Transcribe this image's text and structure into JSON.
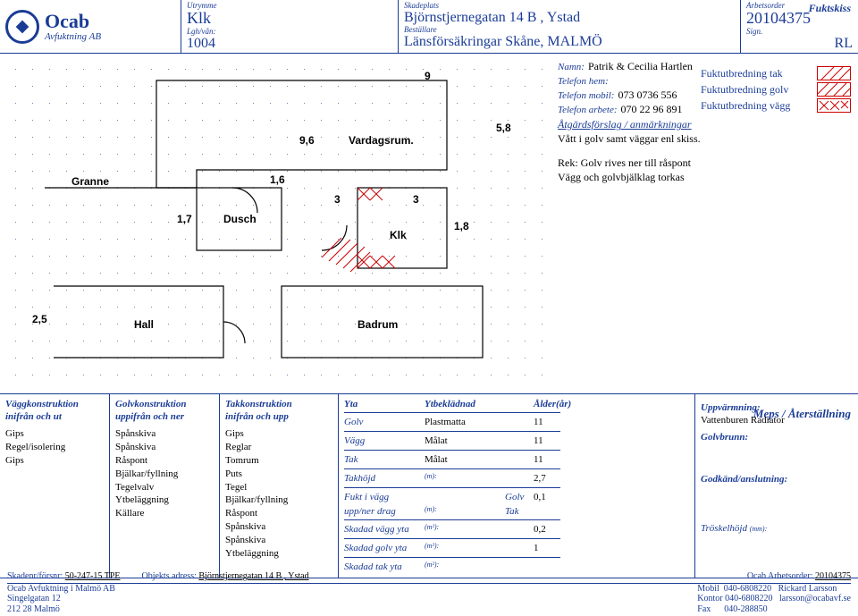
{
  "title_right": "Fuktskiss",
  "logo": {
    "brand": "Ocab",
    "sub": "Avfuktning AB"
  },
  "header": {
    "utrymme_lbl": "Utrymme",
    "utrymme": "Klk",
    "lgh_lbl": "Lgh/vån:",
    "lgh": "1004",
    "skadeplats_lbl": "Skadeplats",
    "skadeplats": "Björnstjernegatan 14 B , Ystad",
    "bestallare_lbl": "Beställare",
    "bestallare": "Länsförsäkringar Skåne, MALMÖ",
    "arbetsorder_lbl": "Arbetsorder",
    "arbetsorder": "20104375",
    "sign_lbl": "Sign.",
    "sign": "RL"
  },
  "contact": {
    "namn_lbl": "Namn:",
    "namn": "Patrik & Cecilia Hartlen",
    "hem_lbl": "Telefon hem:",
    "hem": "",
    "mobil_lbl": "Telefon mobil:",
    "mobil": "073 0736 556",
    "arbete_lbl": "Telefon arbete:",
    "arbete": "070 22 96 891"
  },
  "atg_hdr": "Åtgärdsförslag / anmärkningar",
  "atg1": "Vått i golv samt väggar enl skiss.",
  "atg2": "Rek: Golv rives ner till råspont",
  "atg3": "Vägg och golvbjälklag torkas",
  "legend": {
    "tak": "Fuktutbredning tak",
    "golv": "Fuktutbredning golv",
    "vagg": "Fuktutbredning vägg"
  },
  "plan": {
    "m96": "9,6",
    "vardagsrum": "Vardagsrum.",
    "m9": "9",
    "m58": "5,8",
    "granne": "Granne",
    "m16": "1,6",
    "m17": "1,7",
    "dusch": "Dusch",
    "m3b": "3",
    "m3a": "3",
    "klk": "Klk",
    "m18": "1,8",
    "m25": "2,5",
    "hall": "Hall",
    "badrum": "Badrum"
  },
  "meps": "Meps / Återställning",
  "cols": {
    "vagg_h1": "Väggkonstruktion",
    "vagg_h2": "inifrån och ut",
    "vagg": [
      "Gips",
      "Regel/isolering",
      "Gips"
    ],
    "golv_h1": "Golvkonstruktion",
    "golv_h2": "uppifrån och ner",
    "golv": [
      "Spånskiva",
      "Spånskiva",
      "Råspont",
      "Bjälkar/fyllning",
      "Tegelvalv",
      "Ytbeläggning",
      "Källare"
    ],
    "tak_h1": "Takkonstruktion",
    "tak_h2": "inifrån och upp",
    "tak": [
      "Gips",
      "Reglar",
      "Tomrum",
      "Puts",
      "Tegel",
      "Bjälkar/fyllning",
      "Råspont",
      "Spånskiva",
      "Spånskiva",
      "Ytbeläggning"
    ]
  },
  "yt": {
    "h_yta": "Yta",
    "h_bek": "Ytbeklädnad",
    "h_ald": "Ålder(år)",
    "golv_l": "Golv",
    "golv_b": "Plastmatta",
    "golv_a": "11",
    "vagg_l": "Vägg",
    "vagg_b": "Målat",
    "vagg_a": "11",
    "tak_l": "Tak",
    "tak_b": "Målat",
    "tak_a": "11",
    "takh_l": "Takhöjd",
    "takh_u": "(m):",
    "takh_v": "2,7",
    "fukt_l": "Fukt i vägg",
    "fukt_g": "Golv",
    "fukt_v": "0,1",
    "upp_l": "upp/ner drag",
    "upp_u": "(m):",
    "upp_t": "Tak",
    "svy_l": "Skadad vägg yta",
    "svy_u": "(m²):",
    "svy_v": "0,2",
    "sgy_l": "Skadad golv yta",
    "sgy_u": "(m²):",
    "sgy_v": "1",
    "sty_l": "Skadad tak yta",
    "sty_u": "(m²):"
  },
  "right": {
    "upp": "Uppvärmning:",
    "upp_v": "Vattenburen Radiator",
    "gb": "Golvbrunn:",
    "ga": "Godkänd/anslutning:",
    "tr": "Tröskelhöjd",
    "tr_u": "(mm):"
  },
  "footer": {
    "skadenr_l": "Skadenr/försnr:",
    "skadenr": "50-247-15 TPE",
    "obj_l": "Objekts adress:",
    "obj": "Björnstjernegatan 14 B , Ystad",
    "oa_l": "Ocab Arbetsorder:",
    "oa": "20104375",
    "co": "Ocab Avfuktning i Malmö AB",
    "a1": "Singelgatan 12",
    "a2": "212 28 Malmö",
    "m_l": "Mobil",
    "m": "040-6808220",
    "name": "Rickard Larsson",
    "k_l": "Kontor",
    "k": "040-6808220",
    "mail": "larsson@ocabavf.se",
    "f_l": "Fax",
    "f": "040-288850"
  }
}
